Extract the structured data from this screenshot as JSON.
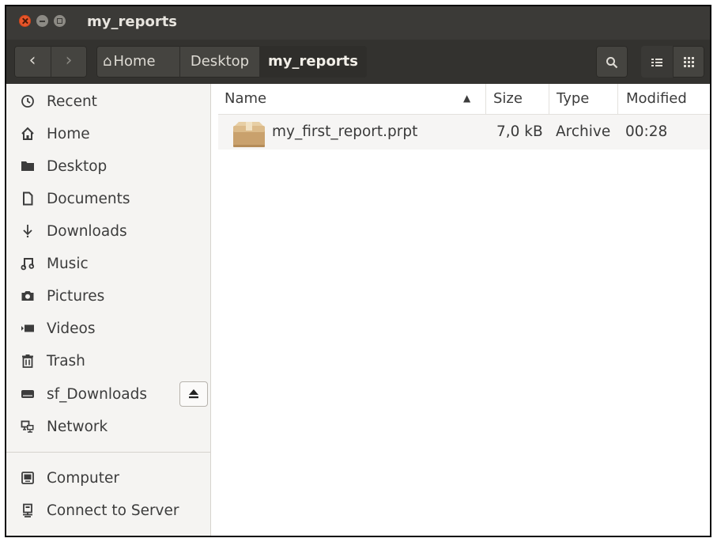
{
  "window": {
    "title": "my_reports"
  },
  "toolbar": {
    "back_icon": "chevron-left-icon",
    "forward_icon": "chevron-right-icon",
    "breadcrumbs": [
      "Home",
      "Desktop",
      "my_reports"
    ],
    "search_icon": "search-icon",
    "view_list_icon": "list-view-icon",
    "view_grid_icon": "grid-view-icon"
  },
  "sidebar": {
    "items": [
      {
        "label": "Recent",
        "icon": "clock-icon"
      },
      {
        "label": "Home",
        "icon": "home-icon"
      },
      {
        "label": "Desktop",
        "icon": "folder-icon"
      },
      {
        "label": "Documents",
        "icon": "document-icon"
      },
      {
        "label": "Downloads",
        "icon": "download-icon"
      },
      {
        "label": "Music",
        "icon": "music-icon"
      },
      {
        "label": "Pictures",
        "icon": "camera-icon"
      },
      {
        "label": "Videos",
        "icon": "video-icon"
      },
      {
        "label": "Trash",
        "icon": "trash-icon"
      },
      {
        "label": "sf_Downloads",
        "icon": "drive-icon"
      },
      {
        "label": "Network",
        "icon": "network-icon"
      },
      {
        "label": "Computer",
        "icon": "computer-icon"
      },
      {
        "label": "Connect to Server",
        "icon": "server-icon"
      }
    ],
    "eject_icon": "eject-icon"
  },
  "file_list": {
    "columns": [
      "Name",
      "Size",
      "Type",
      "Modified"
    ],
    "sort_column": "Name",
    "sort_direction": "ascending",
    "rows": [
      {
        "name": "my_first_report.prpt",
        "size": "7,0 kB",
        "type": "Archive",
        "modified": "00:28",
        "icon": "package-icon"
      }
    ]
  },
  "colors": {
    "titlebar": "#3b3a37",
    "close_button": "#e9562a",
    "sidebar_bg": "#f5f4f2",
    "row_bg": "#f6f5f4"
  }
}
